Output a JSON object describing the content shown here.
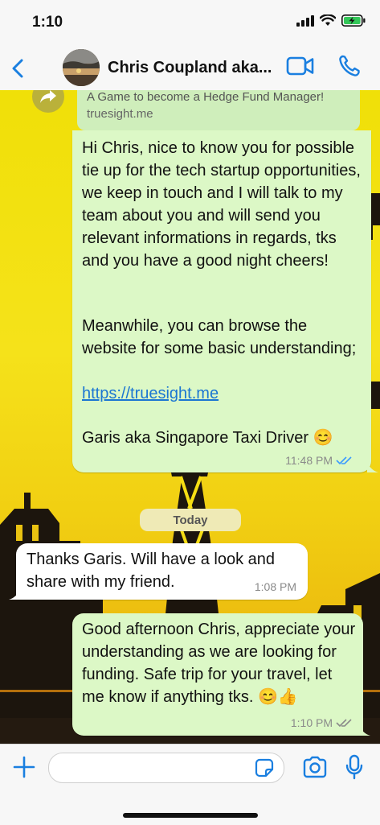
{
  "status_bar": {
    "time": "1:10"
  },
  "header": {
    "contact_name": "Chris Coupland aka..."
  },
  "chat": {
    "link_preview": {
      "description": "A Game to become a Hedge Fund Manager!",
      "domain": "truesight.me"
    },
    "messages": [
      {
        "direction": "outgoing",
        "paragraph1": "Hi Chris, nice to know you for possible tie up for the tech startup opportunities, we keep in touch and I will talk to my team about you and will send you relevant informations in regards, tks and you have a good night cheers!",
        "paragraph2": "Meanwhile, you can browse the website for some basic understanding;",
        "link": "https://truesight.me",
        "signature": "Garis aka Singapore Taxi Driver 😊",
        "time": "11:48 PM"
      },
      {
        "direction": "incoming",
        "text": "Thanks Garis. Will have a look and share with my friend.",
        "time": "1:08 PM"
      },
      {
        "direction": "outgoing",
        "text": "Good afternoon Chris, appreciate your understanding as we are looking for funding. Safe trip for your travel, let me know if anything tks. 😊👍",
        "time": "1:10 PM"
      }
    ],
    "date_divider": "Today"
  },
  "colors": {
    "accent": "#1a7fe0",
    "outgoing_bubble": "#dcf8c6",
    "incoming_bubble": "#ffffff",
    "read_ticks": "#3b9bff"
  },
  "icons": {
    "back": "chevron-left-icon",
    "video": "video-camera-icon",
    "call": "phone-icon",
    "forward": "forward-arrow-icon",
    "attach": "plus-icon",
    "sticker": "sticker-icon",
    "camera": "camera-icon",
    "mic": "microphone-icon"
  }
}
